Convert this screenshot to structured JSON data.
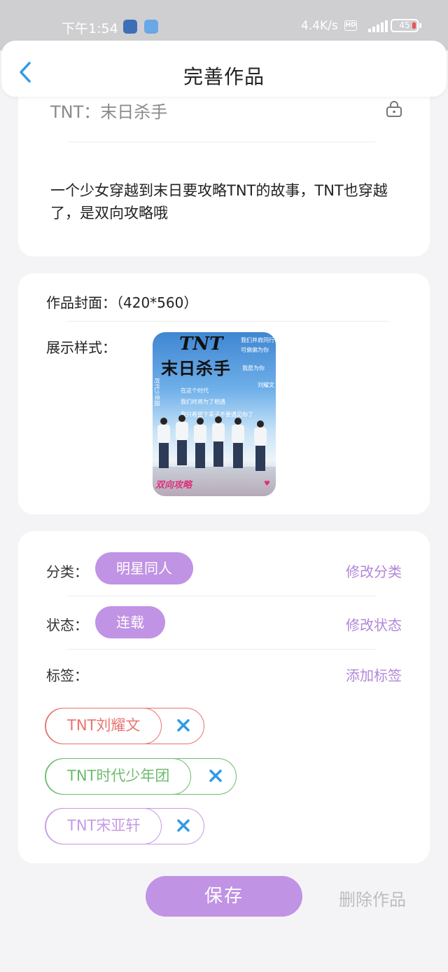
{
  "status_bar": {
    "time": "下午1:54",
    "net_speed": "4.4K/s",
    "hd": "HD",
    "battery": "45",
    "icons": [
      "app-icon-1",
      "app-icon-2",
      "signal-icon",
      "battery-icon"
    ]
  },
  "header": {
    "title": "完善作品",
    "back_icon": "chevron-left-icon"
  },
  "work": {
    "title": "TNT：末日杀手",
    "lock_icon": "lock-icon",
    "description": "一个少女穿越到末日要攻略TNT的故事，TNT也穿越了，是双向攻略哦"
  },
  "cover": {
    "label": "作品封面：（420*560）",
    "style_label": "展示样式：",
    "image": {
      "title_top": "TNT",
      "title_main": "末日杀手",
      "lines": [
        "我们并肩同行",
        "可偏偏为你",
        "我愿为你",
        "刘耀文",
        "在这个时代",
        "我们终将为了相遇",
        "我只希望下辈子不要遇见你了",
        "时代少年团"
      ],
      "bottom_text": "双向攻略"
    }
  },
  "classification": {
    "category_label": "分类：",
    "category_value": "明星同人",
    "category_action": "修改分类",
    "status_label": "状态：",
    "status_value": "连载",
    "status_action": "修改状态",
    "tags_label": "标签：",
    "tags_action": "添加标签",
    "tags": [
      {
        "text": "TNT刘耀文",
        "color": "#e8736f"
      },
      {
        "text": "TNT时代少年团",
        "color": "#6dbb6d"
      },
      {
        "text": "TNT宋亚轩",
        "color": "#c79ae6"
      }
    ],
    "remove_icon": "close-icon"
  },
  "footer": {
    "save_label": "保存",
    "delete_label": "删除作品"
  },
  "colors": {
    "accent": "#c093e4",
    "action_text": "#b287d8",
    "close_icon": "#2f9be6"
  }
}
